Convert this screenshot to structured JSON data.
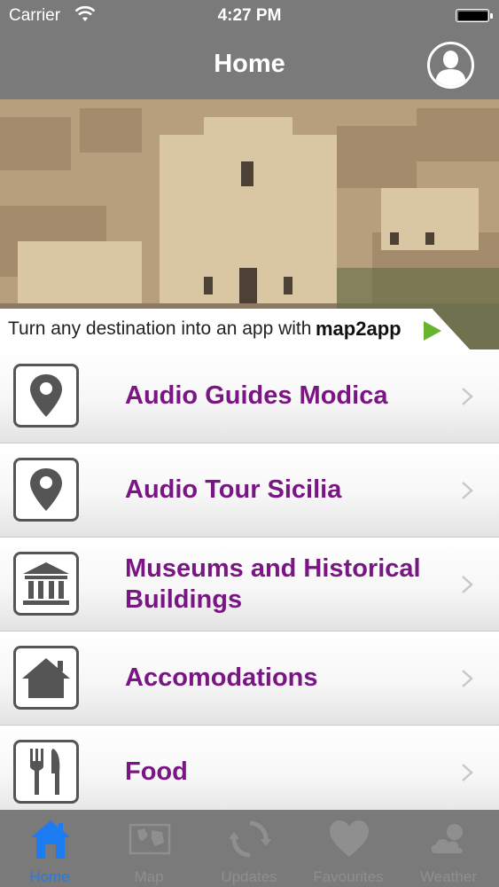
{
  "status_bar": {
    "carrier": "Carrier",
    "time": "4:27 PM"
  },
  "header": {
    "title": "Home"
  },
  "banner": {
    "text": "Turn any destination into an app with",
    "brand": "map2app"
  },
  "menu": [
    {
      "label": "Audio Guides Modica",
      "icon": "map-pin-icon"
    },
    {
      "label": "Audio Tour Sicilia",
      "icon": "map-pin-icon"
    },
    {
      "label": "Museums and Historical Buildings",
      "icon": "museum-icon"
    },
    {
      "label": "Accomodations",
      "icon": "house-icon"
    },
    {
      "label": "Food",
      "icon": "fork-knife-icon"
    }
  ],
  "tabs": [
    {
      "label": "Home",
      "icon": "home-icon",
      "active": true
    },
    {
      "label": "Map",
      "icon": "map-icon",
      "active": false
    },
    {
      "label": "Updates",
      "icon": "refresh-icon",
      "active": false
    },
    {
      "label": "Favourites",
      "icon": "heart-icon",
      "active": false
    },
    {
      "label": "Weather",
      "icon": "weather-icon",
      "active": false
    }
  ],
  "colors": {
    "header": "#7a7a7a",
    "menu_text": "#7a1683",
    "active_tab": "#1e7cf2",
    "inactive_tab": "#8f8f8f"
  }
}
